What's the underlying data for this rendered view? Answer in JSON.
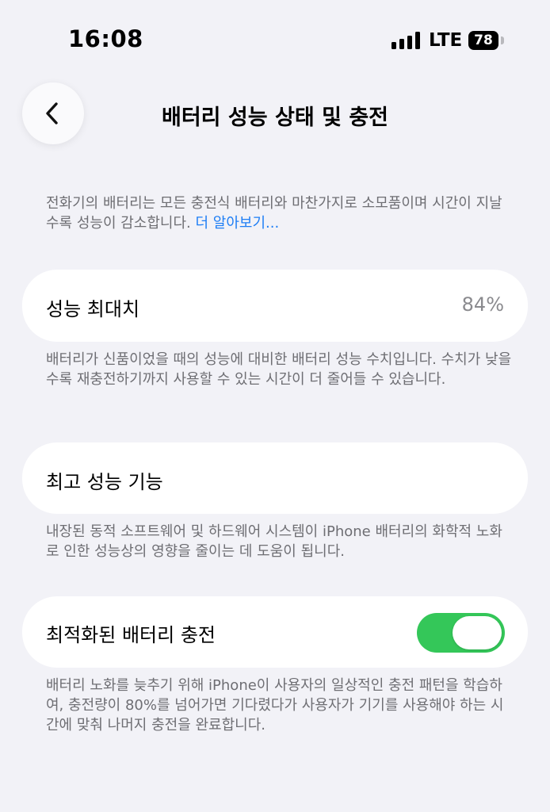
{
  "status_bar": {
    "time": "16:08",
    "carrier": "LTE",
    "battery_level": "78"
  },
  "header": {
    "title": "배터리 성능 상태 및 충전",
    "back_icon": "chevron-left-icon"
  },
  "intro": {
    "text": "전화기의 배터리는 모든 충전식 배터리와 마찬가지로 소모품이며 시간이 지날수록 성능이 감소합니다. ",
    "link": "더 알아보기..."
  },
  "max_capacity": {
    "label": "성능 최대치",
    "value": "84%",
    "footnote": "배터리가 신품이었을 때의 성능에 대비한 배터리 성능 수치입니다. 수치가 낮을수록 재충전하기까지 사용할 수 있는 시간이 더 줄어들 수 있습니다."
  },
  "peak_performance": {
    "label": "최고 성능 기능",
    "footnote": "내장된 동적 소프트웨어 및 하드웨어 시스템이 iPhone 배터리의 화학적 노화로 인한 성능상의 영향을 줄이는 데 도움이 됩니다."
  },
  "optimized_charging": {
    "label": "최적화된 배터리 충전",
    "enabled": true,
    "toggle_color": "#34c759",
    "footnote": "배터리 노화를 늦추기 위해 iPhone이 사용자의 일상적인 충전 패턴을 학습하여, 충전량이 80%를 넘어가면 기다렸다가 사용자가 기기를 사용해야 하는 시간에 맞춰 나머지 충전을 완료합니다."
  }
}
